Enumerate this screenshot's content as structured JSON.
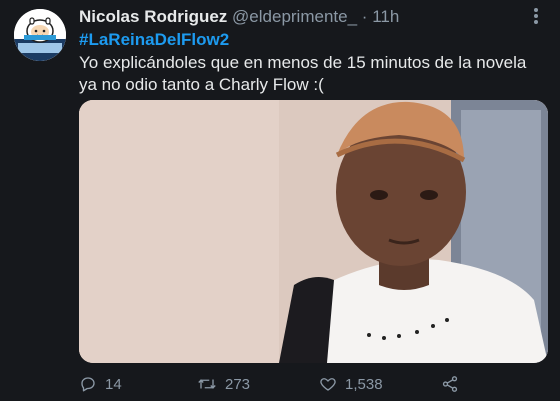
{
  "tweet": {
    "display_name": "Nicolas Rodriguez",
    "handle": "@eldeprimente_",
    "separator": "·",
    "time": "11h",
    "hashtag": "#LaReinaDelFlow2",
    "text": "Yo explicándoles que en menos de 15 minutos de la novela ya no odio tanto a Charly Flow :(",
    "media": {
      "alt_icon": "photo"
    },
    "avatar": {
      "icon": "cartoon-avatar"
    },
    "more_icon": "more-vertical-icon"
  },
  "actions": {
    "reply": {
      "icon": "reply-icon",
      "count": "14"
    },
    "retweet": {
      "icon": "retweet-icon",
      "count": "273"
    },
    "like": {
      "icon": "heart-icon",
      "count": "1,538"
    },
    "share": {
      "icon": "share-icon"
    }
  },
  "colors": {
    "background": "#16181c",
    "text": "#e7e9ea",
    "muted": "#8b98a5",
    "accent": "#1d9bf0"
  }
}
